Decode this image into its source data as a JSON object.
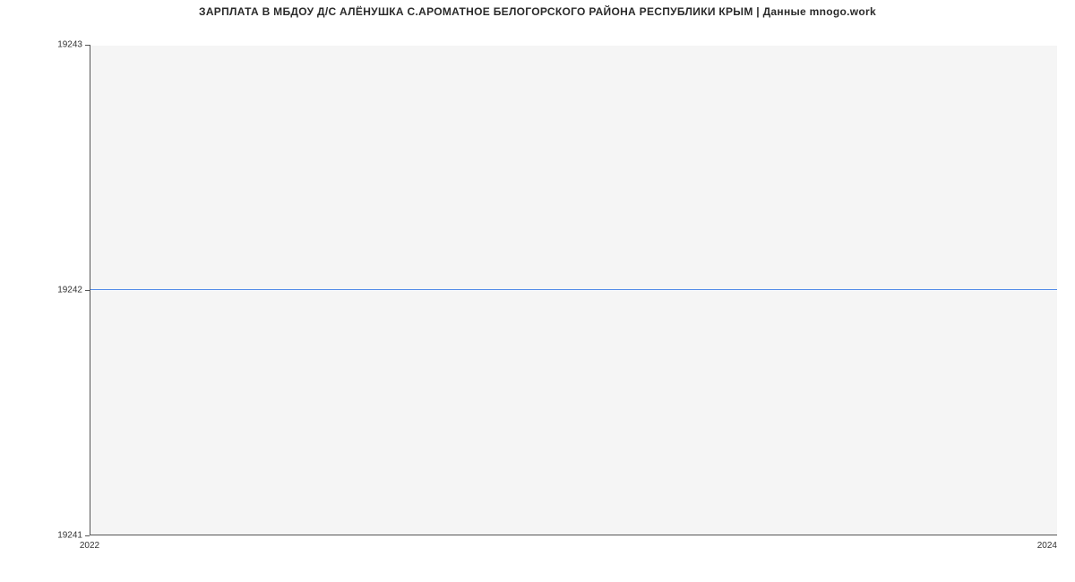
{
  "title": "ЗАРПЛАТА В МБДОУ Д/С АЛЁНУШКА С.АРОМАТНОЕ БЕЛОГОРСКОГО РАЙОНА РЕСПУБЛИКИ КРЫМ | Данные mnogo.work",
  "y_ticks": {
    "top": "19243",
    "mid": "19242",
    "bot": "19241"
  },
  "x_ticks": {
    "left": "2022",
    "right": "2024"
  },
  "chart_data": {
    "type": "line",
    "title": "ЗАРПЛАТА В МБДОУ Д/С АЛЁНУШКА С.АРОМАТНОЕ БЕЛОГОРСКОГО РАЙОНА РЕСПУБЛИКИ КРЫМ | Данные mnogo.work",
    "xlabel": "",
    "ylabel": "",
    "x": [
      2022,
      2024
    ],
    "values": [
      19242,
      19242
    ],
    "ylim": [
      19241,
      19243
    ],
    "xlim": [
      2022,
      2024
    ]
  }
}
